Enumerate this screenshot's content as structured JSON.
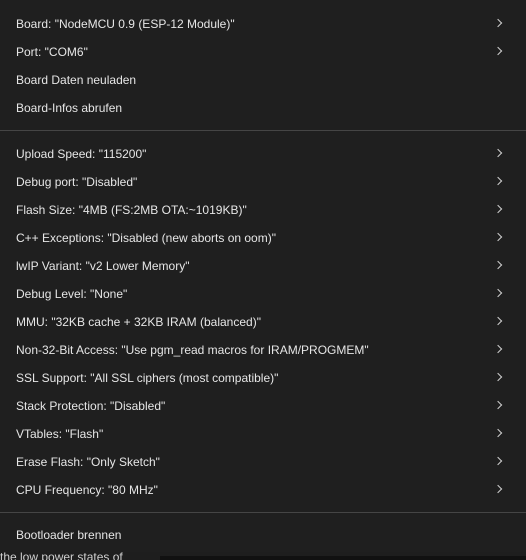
{
  "menu": {
    "group1": [
      {
        "label": "Board: \"NodeMCU 0.9 (ESP-12 Module)\"",
        "submenu": true
      },
      {
        "label": "Port: \"COM6\"",
        "submenu": true
      },
      {
        "label": "Board Daten neuladen",
        "submenu": false
      },
      {
        "label": "Board-Infos abrufen",
        "submenu": false
      }
    ],
    "group2": [
      {
        "label": "Upload Speed: \"115200\"",
        "submenu": true
      },
      {
        "label": "Debug port: \"Disabled\"",
        "submenu": true
      },
      {
        "label": "Flash Size: \"4MB (FS:2MB OTA:~1019KB)\"",
        "submenu": true
      },
      {
        "label": "C++ Exceptions: \"Disabled (new aborts on oom)\"",
        "submenu": true
      },
      {
        "label": "lwIP Variant: \"v2 Lower Memory\"",
        "submenu": true
      },
      {
        "label": "Debug Level: \"None\"",
        "submenu": true
      },
      {
        "label": "MMU: \"32KB cache + 32KB IRAM (balanced)\"",
        "submenu": true
      },
      {
        "label": "Non-32-Bit Access: \"Use pgm_read macros for IRAM/PROGMEM\"",
        "submenu": true
      },
      {
        "label": "SSL Support: \"All SSL ciphers (most compatible)\"",
        "submenu": true
      },
      {
        "label": "Stack Protection: \"Disabled\"",
        "submenu": true
      },
      {
        "label": "VTables: \"Flash\"",
        "submenu": true
      },
      {
        "label": "Erase Flash: \"Only Sketch\"",
        "submenu": true
      },
      {
        "label": "CPU Frequency: \"80 MHz\"",
        "submenu": true
      }
    ],
    "group3": [
      {
        "label": "Bootloader brennen",
        "submenu": false
      }
    ]
  },
  "background": {
    "partial_text": "the low power states of"
  },
  "colors": {
    "menu_bg": "#1f1f1f",
    "text": "#e6e6e6",
    "separator": "#454545"
  }
}
